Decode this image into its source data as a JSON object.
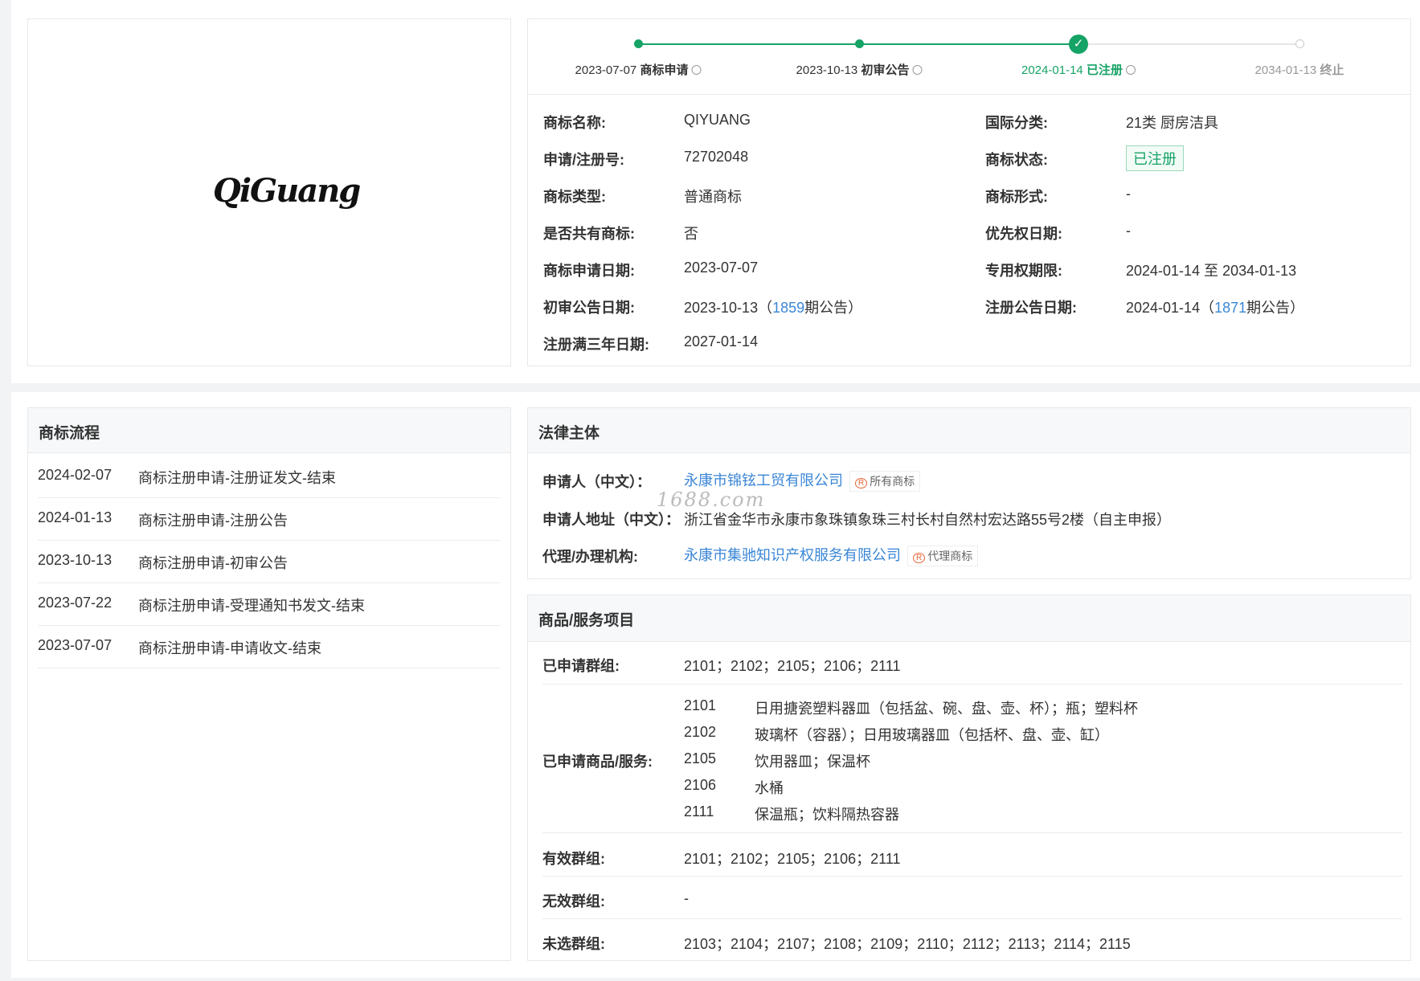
{
  "timeline": [
    {
      "date": "2023-07-07",
      "label": "商标申请",
      "state": "done"
    },
    {
      "date": "2023-10-13",
      "label": "初审公告",
      "state": "done"
    },
    {
      "date": "2024-01-14",
      "label": "已注册",
      "state": "current"
    },
    {
      "date": "2034-01-13",
      "label": "终止",
      "state": "pending"
    }
  ],
  "colors": {
    "accent": "#16a366",
    "link": "#3a86d6"
  },
  "logo_text": "QiGuang",
  "info_left": [
    {
      "label": "商标名称:",
      "value": "QIYUANG"
    },
    {
      "label": "申请/注册号:",
      "value": "72702048"
    },
    {
      "label": "商标类型:",
      "value": "普通商标"
    },
    {
      "label": "是否共有商标:",
      "value": "否"
    },
    {
      "label": "商标申请日期:",
      "value": "2023-07-07"
    },
    {
      "label": "初审公告日期:",
      "value": "2023-10-13（",
      "issue": "1859",
      "suffix": "期公告）"
    },
    {
      "label": "注册满三年日期:",
      "value": "2027-01-14"
    }
  ],
  "info_right": [
    {
      "label": "国际分类:",
      "value": "21类 厨房洁具"
    },
    {
      "label": "商标状态:",
      "value": "已注册"
    },
    {
      "label": "商标形式:",
      "value": "-"
    },
    {
      "label": "优先权日期:",
      "value": "-"
    },
    {
      "label": "专用权期限:",
      "value": "2024-01-14 至 2034-01-13"
    },
    {
      "label": "注册公告日期:",
      "value": "2024-01-14（",
      "issue": "1871",
      "suffix": "期公告）"
    }
  ],
  "flow": {
    "title": "商标流程",
    "items": [
      {
        "date": "2024-02-07",
        "text": "商标注册申请-注册证发文-结束"
      },
      {
        "date": "2024-01-13",
        "text": "商标注册申请-注册公告"
      },
      {
        "date": "2023-10-13",
        "text": "商标注册申请-初审公告"
      },
      {
        "date": "2023-07-22",
        "text": "商标注册申请-受理通知书发文-结束"
      },
      {
        "date": "2023-07-07",
        "text": "商标注册申请-申请收文-结束"
      }
    ]
  },
  "legal": {
    "title": "法律主体",
    "applicant_label": "申请人（中文）：",
    "applicant": "永康市锦铉工贸有限公司",
    "applicant_tag": "所有商标",
    "address_label": "申请人地址（中文）：",
    "address": "浙江省金华市永康市象珠镇象珠三村长村自然村宏达路55号2楼（自主申报）",
    "agent_label": "代理/办理机构:",
    "agent": "永康市集驰知识产权服务有限公司",
    "agent_tag": "代理商标",
    "watermark": "1688.com"
  },
  "goods": {
    "title": "商品/服务项目",
    "groups_label": "已申请群组:",
    "groups": "2101；2102；2105；2106；2111",
    "items_label": "已申请商品/服务:",
    "items": [
      {
        "code": "2101",
        "desc": "日用搪瓷塑料器皿（包括盆、碗、盘、壶、杯）；瓶；塑料杯"
      },
      {
        "code": "2102",
        "desc": "玻璃杯（容器）；日用玻璃器皿（包括杯、盘、壶、缸）"
      },
      {
        "code": "2105",
        "desc": "饮用器皿；保温杯"
      },
      {
        "code": "2106",
        "desc": "水桶"
      },
      {
        "code": "2111",
        "desc": "保温瓶；饮料隔热容器"
      }
    ],
    "valid_label": "有效群组:",
    "valid": "2101；2102；2105；2106；2111",
    "invalid_label": "无效群组:",
    "invalid": "-",
    "unselected_label": "未选群组:",
    "unselected": "2103；2104；2107；2108；2109；2110；2112；2113；2114；2115"
  }
}
